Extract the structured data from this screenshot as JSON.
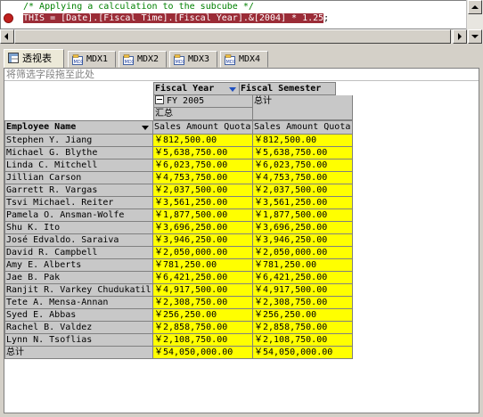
{
  "editor": {
    "comment": "/* Applying a calculation to the subcube */",
    "statement": "THIS = [Date].[Fiscal Time].[Fiscal Year].&[2004] * 1.25",
    "statement_end": ";"
  },
  "tabs": [
    {
      "label": "透视表",
      "icon": "pivot-table-icon",
      "active": true
    },
    {
      "label": "MDX1",
      "icon": "mdx-icon",
      "active": false
    },
    {
      "label": "MDX2",
      "icon": "mdx-icon",
      "active": false
    },
    {
      "label": "MDX3",
      "icon": "mdx-icon",
      "active": false
    },
    {
      "label": "MDX4",
      "icon": "mdx-icon",
      "active": false
    }
  ],
  "pivot": {
    "filter_drop_text": "将筛选字段拖至此处",
    "column_fields": {
      "fiscal_year": "Fiscal Year",
      "fiscal_semester": "Fiscal Semester"
    },
    "column_members": {
      "fy": "FY 2005",
      "fy_total": "汇总",
      "grand_total": "总计"
    },
    "measure_headers": [
      "Sales Amount Quota",
      "Sales Amount Quota"
    ],
    "row_field": "Employee Name",
    "rows": [
      {
        "name": "Stephen Y. Jiang",
        "v1": "￥812,500.00",
        "v2": "￥812,500.00"
      },
      {
        "name": "Michael G. Blythe",
        "v1": "￥5,638,750.00",
        "v2": "￥5,638,750.00"
      },
      {
        "name": "Linda C. Mitchell",
        "v1": "￥6,023,750.00",
        "v2": "￥6,023,750.00"
      },
      {
        "name": "Jillian Carson",
        "v1": "￥4,753,750.00",
        "v2": "￥4,753,750.00"
      },
      {
        "name": "Garrett R. Vargas",
        "v1": "￥2,037,500.00",
        "v2": "￥2,037,500.00"
      },
      {
        "name": "Tsvi Michael. Reiter",
        "v1": "￥3,561,250.00",
        "v2": "￥3,561,250.00"
      },
      {
        "name": "Pamela O. Ansman-Wolfe",
        "v1": "￥1,877,500.00",
        "v2": "￥1,877,500.00"
      },
      {
        "name": "Shu K. Ito",
        "v1": "￥3,696,250.00",
        "v2": "￥3,696,250.00"
      },
      {
        "name": "José Edvaldo. Saraiva",
        "v1": "￥3,946,250.00",
        "v2": "￥3,946,250.00"
      },
      {
        "name": "David R. Campbell",
        "v1": "￥2,050,000.00",
        "v2": "￥2,050,000.00"
      },
      {
        "name": "Amy E. Alberts",
        "v1": "￥781,250.00",
        "v2": "￥781,250.00"
      },
      {
        "name": "Jae B. Pak",
        "v1": "￥6,421,250.00",
        "v2": "￥6,421,250.00"
      },
      {
        "name": "Ranjit R. Varkey Chudukatil",
        "v1": "￥4,917,500.00",
        "v2": "￥4,917,500.00"
      },
      {
        "name": "Tete A. Mensa-Annan",
        "v1": "￥2,308,750.00",
        "v2": "￥2,308,750.00"
      },
      {
        "name": "Syed E. Abbas",
        "v1": "￥256,250.00",
        "v2": "￥256,250.00"
      },
      {
        "name": "Rachel B. Valdez",
        "v1": "￥2,858,750.00",
        "v2": "￥2,858,750.00"
      },
      {
        "name": "Lynn N. Tsoflias",
        "v1": "￥2,108,750.00",
        "v2": "￥2,108,750.00"
      }
    ],
    "total_row": {
      "name": "总计",
      "v1": "￥54,050,000.00",
      "v2": "￥54,050,000.00"
    }
  },
  "colors": {
    "highlight": "#9b2c37",
    "data_cell": "#ffff00",
    "header_cell": "#c8c8c8",
    "comment": "#008000"
  }
}
